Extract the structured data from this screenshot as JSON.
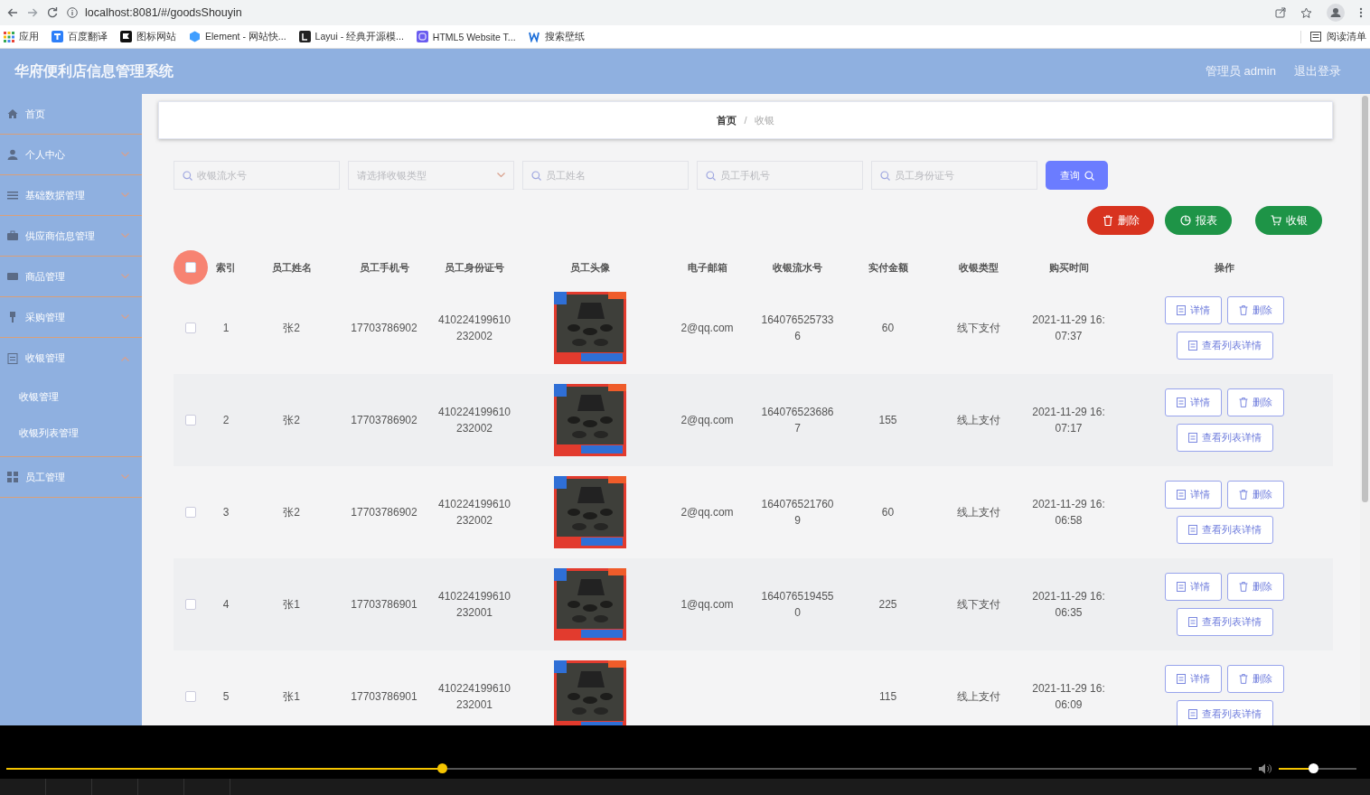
{
  "browser": {
    "url": "localhost:8081/#/goodsShouyin",
    "reading_list": "阅读清单",
    "bookmarks": [
      {
        "label": "应用"
      },
      {
        "label": "百度翻译"
      },
      {
        "label": "图标网站"
      },
      {
        "label": "Element - 网站快..."
      },
      {
        "label": "Layui - 经典开源模..."
      },
      {
        "label": "HTML5 Website T..."
      },
      {
        "label": "搜索壁纸"
      }
    ]
  },
  "header": {
    "title": "华府便利店信息管理系统",
    "user": "管理员 admin",
    "logout": "退出登录"
  },
  "sidebar": {
    "items": [
      {
        "label": "首页"
      },
      {
        "label": "个人中心",
        "expanded": false
      },
      {
        "label": "基础数据管理",
        "expanded": false
      },
      {
        "label": "供应商信息管理",
        "expanded": false
      },
      {
        "label": "商品管理",
        "expanded": false
      },
      {
        "label": "采购管理",
        "expanded": false
      },
      {
        "label": "收银管理",
        "expanded": true,
        "children": [
          {
            "label": "收银管理"
          },
          {
            "label": "收银列表管理"
          }
        ]
      },
      {
        "label": "员工管理",
        "expanded": false
      }
    ]
  },
  "breadcrumb": {
    "items": [
      "首页",
      "收银"
    ],
    "separator": "/"
  },
  "search": {
    "fields": [
      {
        "kind": "text",
        "placeholder": "收银流水号"
      },
      {
        "kind": "select",
        "placeholder": "请选择收银类型"
      },
      {
        "kind": "text",
        "placeholder": "员工姓名"
      },
      {
        "kind": "text",
        "placeholder": "员工手机号"
      },
      {
        "kind": "text",
        "placeholder": "员工身份证号"
      }
    ],
    "button": "查询"
  },
  "actions": [
    {
      "kind": "danger",
      "label": "删除"
    },
    {
      "kind": "success",
      "label": "报表"
    },
    {
      "kind": "success",
      "label": "收银"
    }
  ],
  "table": {
    "select_all": {
      "checked": false
    },
    "columns": [
      "索引",
      "员工姓名",
      "员工手机号",
      "员工身份证号",
      "员工头像",
      "电子邮箱",
      "收银流水号",
      "实付金额",
      "收银类型",
      "购买时间",
      "操作"
    ],
    "rows": [
      {
        "checked": false,
        "index": "1",
        "name": "张2",
        "phone": "17703786902",
        "id_number": "410224199610232002",
        "email": "2@qq.com",
        "serial": "1640765257336",
        "amount": "60",
        "pay_type": "线下支付",
        "time": "2021-11-29 16:07:37",
        "actions": [
          "详情",
          "删除",
          "查看列表详情"
        ]
      },
      {
        "checked": false,
        "index": "2",
        "name": "张2",
        "phone": "17703786902",
        "id_number": "410224199610232002",
        "email": "2@qq.com",
        "serial": "1640765236867",
        "amount": "155",
        "pay_type": "线上支付",
        "time": "2021-11-29 16:07:17",
        "actions": [
          "详情",
          "删除",
          "查看列表详情"
        ]
      },
      {
        "checked": false,
        "index": "3",
        "name": "张2",
        "phone": "17703786902",
        "id_number": "410224199610232002",
        "email": "2@qq.com",
        "serial": "1640765217609",
        "amount": "60",
        "pay_type": "线上支付",
        "time": "2021-11-29 16:06:58",
        "actions": [
          "详情",
          "删除",
          "查看列表详情"
        ]
      },
      {
        "checked": false,
        "index": "4",
        "name": "张1",
        "phone": "17703786901",
        "id_number": "410224199610232001",
        "email": "1@qq.com",
        "serial": "1640765194550",
        "amount": "225",
        "pay_type": "线下支付",
        "time": "2021-11-29 16:06:35",
        "actions": [
          "详情",
          "删除",
          "查看列表详情"
        ]
      },
      {
        "checked": false,
        "index": "5",
        "name": "张1",
        "phone": "17703786901",
        "id_number": "410224199610232001",
        "amount": "115",
        "pay_type": "线上支付",
        "time": "2021-11-29 16:06:09",
        "actions": [
          "详情",
          "删除",
          "查看列表详情"
        ]
      }
    ]
  },
  "player": {
    "progress": {
      "level": 0.35
    },
    "volume": {
      "level": 0.44
    }
  }
}
